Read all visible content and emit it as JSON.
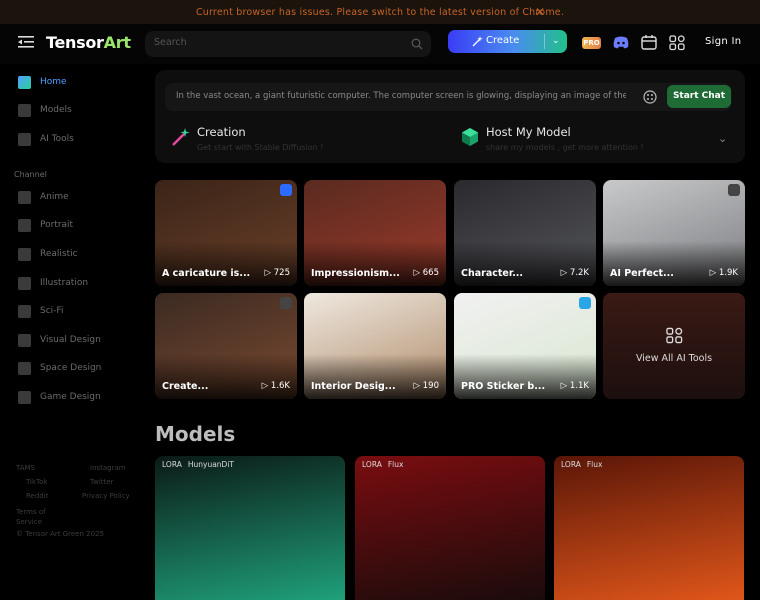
{
  "banner": {
    "message": "Current browser has issues. Please switch to the latest version of Chrome.",
    "close": "✕"
  },
  "header": {
    "logo_main": "Tensor",
    "logo_accent": "Art",
    "search_placeholder": "Search",
    "create_label": "Create",
    "pro_badge": "PRO",
    "signin_label": "Sign In"
  },
  "sidebar": {
    "items": [
      {
        "label": "Home",
        "icon": "home-icon",
        "active": true
      },
      {
        "label": "Models",
        "icon": "cube-icon"
      },
      {
        "label": "AI Tools",
        "icon": "tools-icon"
      }
    ],
    "channel_heading": "Channel",
    "channels": [
      {
        "label": "Anime",
        "icon": "anime-icon"
      },
      {
        "label": "Portrait",
        "icon": "portrait-icon"
      },
      {
        "label": "Realistic",
        "icon": "camera-icon"
      },
      {
        "label": "Illustration",
        "icon": "brush-icon"
      },
      {
        "label": "Sci-Fi",
        "icon": "ufo-icon"
      },
      {
        "label": "Visual Design",
        "icon": "visual-design-icon"
      },
      {
        "label": "Space Design",
        "icon": "space-design-icon"
      },
      {
        "label": "Game Design",
        "icon": "gamepad-icon"
      }
    ],
    "footer": {
      "tams": "TAMS",
      "instagram": "Instagram",
      "tiktok": "TikTok",
      "twitter": "Twitter",
      "reddit": "Reddit",
      "privacy": "Privacy Policy",
      "terms": "Terms of Service",
      "copyright": "© Tensor Art Green 2025"
    }
  },
  "prompt": {
    "text": "In the vast ocean, a giant futuristic computer. The computer screen is glowing, displaying an image of the",
    "chat_button": "Start Chat"
  },
  "features": [
    {
      "title": "Creation",
      "subtitle": "Get start with Stable Diffusion !"
    },
    {
      "title": "Host My Model",
      "subtitle": "share my models , get more attention !"
    }
  ],
  "tools": [
    {
      "caption": "A caricature is...",
      "count": "725",
      "bg1": "#3a2418",
      "bg2": "#6b4028",
      "badge_color": "#2b6bff"
    },
    {
      "caption": "Impressionism...",
      "count": "665",
      "bg1": "#5a2a20",
      "bg2": "#9b3a2a",
      "badge_color": ""
    },
    {
      "caption": "Character...",
      "count": "7.2K",
      "bg1": "#2a2a2e",
      "bg2": "#55565a",
      "badge_color": ""
    },
    {
      "caption": "AI Perfect...",
      "count": "1.9K",
      "bg1": "#c8c9cb",
      "bg2": "#7c7d80",
      "badge_color": "#444"
    },
    {
      "caption": "Create...",
      "count": "1.6K",
      "bg1": "#3b2a22",
      "bg2": "#7a4a30",
      "badge_color": "#444"
    },
    {
      "caption": "Interior Desig...",
      "count": "190",
      "bg1": "#efe9e0",
      "bg2": "#b08b6a",
      "badge_color": ""
    },
    {
      "caption": "PRO Sticker b...",
      "count": "1.1K",
      "bg1": "#f1f1f1",
      "bg2": "#d9e6d0",
      "badge_color": "#2aa6e8"
    }
  ],
  "view_all": "View All AI Tools",
  "models_heading": "Models",
  "models": [
    {
      "tags": [
        "LORA",
        "HunyuanDiT"
      ],
      "bg1": "#0b1a16",
      "bg2": "#1fa07a"
    },
    {
      "tags": [
        "LORA",
        "Flux"
      ],
      "bg1": "#7a0d10",
      "bg2": "#1a0b0b"
    },
    {
      "tags": [
        "LORA",
        "Flux"
      ],
      "bg1": "#5a1608",
      "bg2": "#e0561a"
    }
  ]
}
